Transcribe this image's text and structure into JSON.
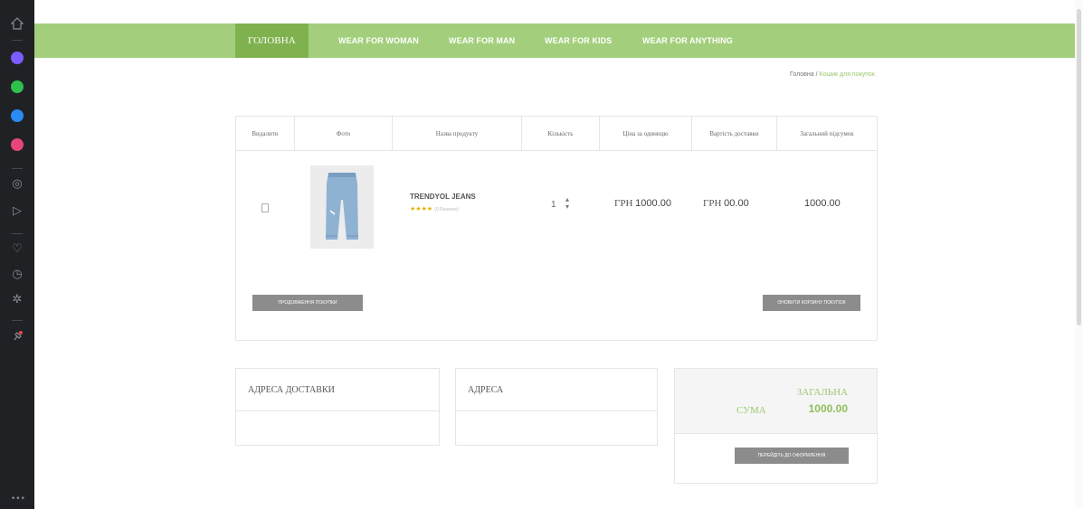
{
  "sidebar": {
    "items": [
      {
        "icon": "home-icon",
        "color": "#8a8d93"
      },
      {
        "icon": "messenger-icon",
        "color": "#7b5cff"
      },
      {
        "icon": "whatsapp-icon",
        "color": "#2fbf4d"
      },
      {
        "icon": "telegram-icon",
        "color": "#2a8bf2"
      },
      {
        "icon": "instagram-icon",
        "color": "#e8457a"
      },
      {
        "icon": "settings-dial-icon",
        "color": "#8a8d93"
      },
      {
        "icon": "send-icon",
        "color": "#8a8d93"
      },
      {
        "icon": "heart-icon",
        "color": "#8a8d93"
      },
      {
        "icon": "clock-icon",
        "color": "#8a8d93"
      },
      {
        "icon": "gear-icon",
        "color": "#8a8d93"
      },
      {
        "icon": "pin-icon",
        "color": "#e84545"
      }
    ],
    "more_label": "•••"
  },
  "nav": {
    "items": [
      {
        "label": "ГОЛОВНА",
        "active": true
      },
      {
        "label": "WEAR FOR WOMAN",
        "active": false
      },
      {
        "label": "WEAR FOR MAN",
        "active": false
      },
      {
        "label": "WEAR FOR KIDS",
        "active": false
      },
      {
        "label": "WEAR FOR ANYTHING",
        "active": false
      }
    ],
    "accent": "#a3cf7c",
    "active_color": "#7fb24e"
  },
  "breadcrumb": {
    "home": "Головна",
    "separator": "/",
    "current": "Кошик для покупок"
  },
  "cart": {
    "headers": [
      "Видалити",
      "Фото",
      "Назва продукту",
      "Кількість",
      "Ціна за одиницю",
      "Вартість доставки",
      "Загальний підсумок"
    ],
    "row": {
      "product_name": "TRENDYOL JEANS",
      "rating": 4,
      "reviews": "(0 Reviews)",
      "quantity": "1",
      "unit_price_currency": "ГРН",
      "unit_price": "1000.00",
      "shipping_currency": "ГРН",
      "shipping": "00.00",
      "total": "1000.00"
    },
    "continue_button": "ПРОДОВЖЕННЯ ПОКУПКИ",
    "update_button": "ОНОВИТИ КОРЗИНУ ПОКУПОК"
  },
  "delivery_address": {
    "title": "АДРЕСА ДОСТАВКИ"
  },
  "address": {
    "title": "АДРЕСА"
  },
  "total": {
    "label_line1": "ЗАГАЛЬНА",
    "label_line2": "СУМА",
    "value": "1000.00",
    "checkout_button": "ПЕРЕЙДІТЬ ДО ОФОРМЛЕННЯ"
  }
}
